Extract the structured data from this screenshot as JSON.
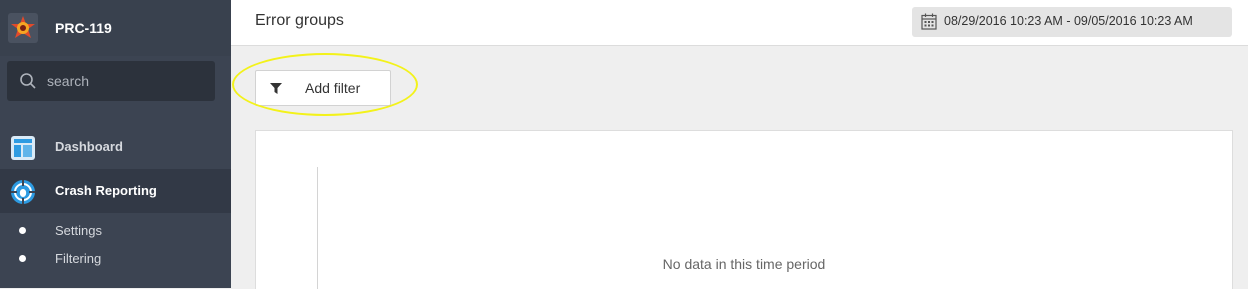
{
  "app": {
    "name": "PRC-119"
  },
  "search": {
    "placeholder": "search"
  },
  "sidebar": {
    "items": [
      {
        "label": "Dashboard",
        "icon": "dashboard-icon"
      },
      {
        "label": "Crash Reporting",
        "icon": "crash-reporting-icon",
        "active": true
      }
    ],
    "subitems": [
      {
        "label": "Settings"
      },
      {
        "label": "Filtering"
      }
    ]
  },
  "header": {
    "title": "Error groups",
    "date_range": "08/29/2016 10:23 AM - 09/05/2016 10:23 AM"
  },
  "toolbar": {
    "add_filter_label": "Add filter"
  },
  "main": {
    "empty_message": "No data in this time period"
  },
  "colors": {
    "sidebar_bg": "#3c4452",
    "active_item_bg": "#323946",
    "accent_blue": "#2d9be2",
    "highlight": "#f3f21a"
  }
}
